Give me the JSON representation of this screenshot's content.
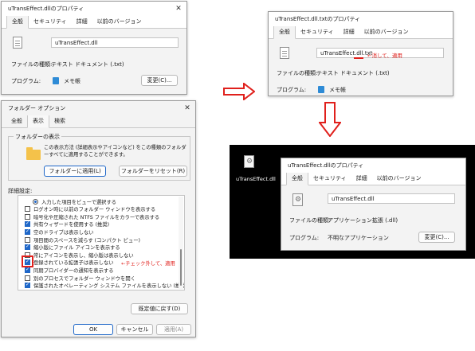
{
  "win1": {
    "title": "uTransEffect.dllのプロパティ",
    "tabs": [
      "全般",
      "セキュリティ",
      "詳細",
      "以前のバージョン"
    ],
    "filename": "uTransEffect.dll",
    "type_label": "ファイルの種類:",
    "type_value": "テキスト ドキュメント (.txt)",
    "program_label": "プログラム:",
    "program_value": "メモ帳",
    "change_button": "変更(C)..."
  },
  "win2": {
    "title": "uTransEffect.dll.txtのプロパティ",
    "tabs": [
      "全般",
      "セキュリティ",
      "詳細",
      "以前のバージョン"
    ],
    "filename": "uTransEffect.dll.txt",
    "annotation": "←消して、適用",
    "type_label": "ファイルの種類:",
    "type_value": "テキスト ドキュメント (.txt)",
    "program_label": "プログラム:",
    "program_value": "メモ帳",
    "change_button": "変更(C)..."
  },
  "win3": {
    "title": "uTransEffect.dllのプロパティ",
    "tabs": [
      "全般",
      "セキュリティ",
      "詳細",
      "以前のバージョン"
    ],
    "filename": "uTransEffect.dll",
    "type_label": "ファイルの種類:",
    "type_value": "アプリケーション拡張 (.dll)",
    "program_label": "プログラム:",
    "program_value": "不明なアプリケーション",
    "change_button": "変更(C)...",
    "desktop_icon_label": "uTransEffect.dll"
  },
  "folder_options": {
    "title": "フォルダー オプション",
    "tabs": [
      "全般",
      "表示",
      "検索"
    ],
    "group_title": "フォルダーの表示",
    "group_text": "この表示方法 (詳細表示やアイコンなど) をこの種類のフォルダーすべてに適用することができます。",
    "apply_button": "フォルダーに適用(L)",
    "reset_button": "フォルダーをリセット(R)",
    "advanced_label": "詳細設定:",
    "items": [
      {
        "kind": "radio",
        "checked": true,
        "text": "入力した項目をビューで選択する",
        "indent": 1
      },
      {
        "kind": "check",
        "checked": false,
        "text": "ログオン時に以前のフォルダー ウィンドウを表示する"
      },
      {
        "kind": "check",
        "checked": false,
        "text": "暗号化や圧縮された NTFS ファイルをカラーで表示する"
      },
      {
        "kind": "check",
        "checked": true,
        "text": "共有ウィザードを使用する (推奨)"
      },
      {
        "kind": "check",
        "checked": true,
        "text": "空のドライブは表示しない"
      },
      {
        "kind": "check",
        "checked": false,
        "text": "項目間のスペースを減らす (コンパクト ビュー)"
      },
      {
        "kind": "check",
        "checked": true,
        "text": "縮小版にファイル アイコンを表示する"
      },
      {
        "kind": "check",
        "checked": false,
        "text": "常にアイコンを表示し、縮小版は表示しない"
      },
      {
        "kind": "check",
        "checked": true,
        "text": "登録されている拡張子は表示しない"
      },
      {
        "kind": "check",
        "checked": true,
        "text": "同期プロバイダーの通知を表示する"
      },
      {
        "kind": "check",
        "checked": false,
        "text": "別のプロセスでフォルダー ウィンドウを開く"
      },
      {
        "kind": "check",
        "checked": true,
        "text": "保護されたオペレーティング システム ファイルを表示しない (推奨)"
      }
    ],
    "annotation": "←チェック外して、適用",
    "restore_button": "既定値に戻す(D)",
    "ok_button": "OK",
    "cancel_button": "キャンセル",
    "apply_bottom_button": "適用(A)"
  },
  "colors": {
    "accent": "#1f67c8",
    "annotation_red": "#e0201c"
  }
}
